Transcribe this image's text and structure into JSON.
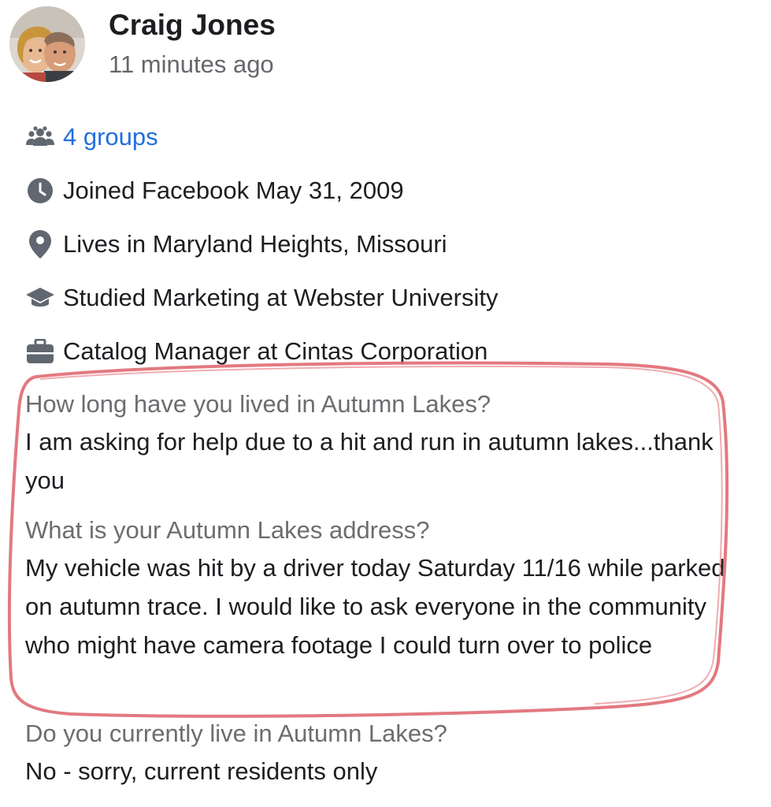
{
  "profile": {
    "name": "Craig Jones",
    "time": "11 minutes ago"
  },
  "info": {
    "groups": "4 groups",
    "joined": "Joined Facebook May 31, 2009",
    "lives": "Lives in Maryland Heights, Missouri",
    "studied": "Studied Marketing at Webster University",
    "work": "Catalog Manager at Cintas Corporation"
  },
  "questions": [
    {
      "question": "How long have you lived in Autumn Lakes?",
      "answer": "I am asking for help due to a hit and run in autumn lakes...thank you"
    },
    {
      "question": "What is your Autumn Lakes address?",
      "answer": "My vehicle was hit by a driver today Saturday 11/16 while parked on autumn trace. I would like to ask everyone in the community who might have camera footage I could turn over to police"
    },
    {
      "question": "Do you currently live in Autumn Lakes?",
      "answer": "No - sorry, current residents only"
    }
  ],
  "icons": {
    "groups": "groups-icon",
    "joined": "clock-icon",
    "lives": "location-pin-icon",
    "studied": "graduation-cap-icon",
    "work": "briefcase-icon"
  },
  "colors": {
    "link": "#216fdb",
    "icon": "#606770",
    "question": "#6b6d70",
    "annotation": "#e06a72"
  }
}
